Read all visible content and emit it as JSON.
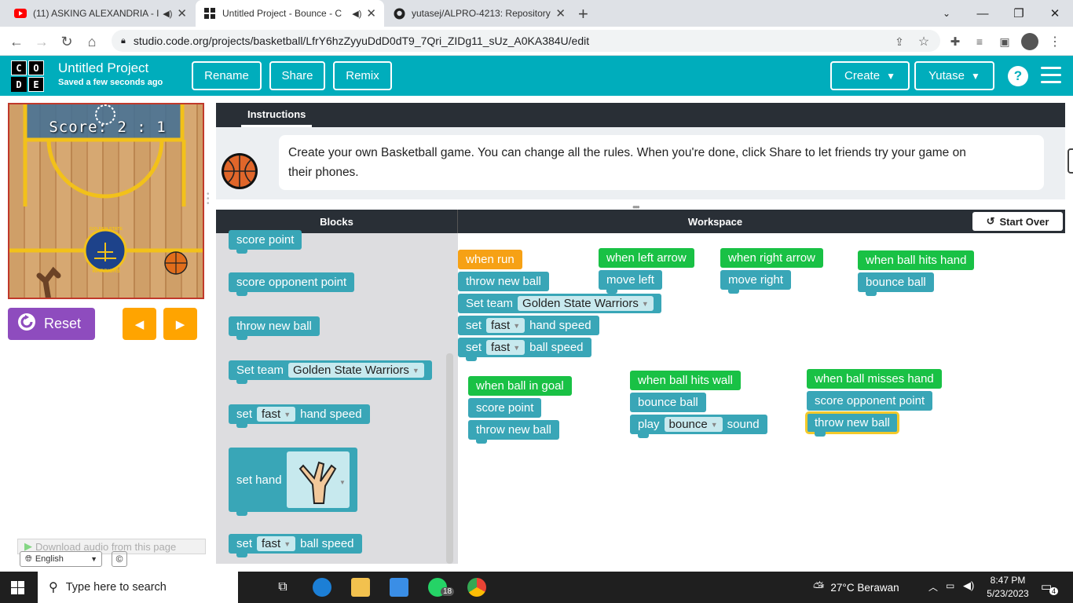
{
  "browser": {
    "tabs": [
      {
        "title": "(11) ASKING ALEXANDRIA - I",
        "icon": "youtube-icon"
      },
      {
        "title": "Untitled Project - Bounce - C",
        "icon": "codeorg-icon"
      },
      {
        "title": "yutasej/ALPRO-4213: Repository",
        "icon": "github-icon"
      }
    ],
    "url": "studio.code.org/projects/basketball/LfrY6hzZyyuDdD0dT9_7Qri_ZIDg11_sUz_A0KA384U/edit"
  },
  "header": {
    "logo_letters": [
      "C",
      "O",
      "D",
      "E"
    ],
    "title": "Untitled Project",
    "subtitle": "Saved a few seconds ago",
    "rename": "Rename",
    "share": "Share",
    "remix": "Remix",
    "create": "Create",
    "user": "Yutase",
    "help": "?"
  },
  "game": {
    "score": "Score: 2 : 1",
    "reset": "Reset",
    "logo_top": "GOLDEN STATE",
    "logo_bottom": "WARRIORS"
  },
  "instructions": {
    "tab": "Instructions",
    "text": "Create your own Basketball game. You can change all the rules. When you're done, click Share to let friends try your game on their phones."
  },
  "panels": {
    "blocks": "Blocks",
    "workspace": "Workspace",
    "start_over": "Start Over"
  },
  "toolbox": {
    "b1": "score point",
    "b2": "score opponent point",
    "b3": "throw new ball",
    "b4": "Set team",
    "b4_dd": "Golden State Warriors",
    "b5_pre": "set",
    "b5_dd": "fast",
    "b5_post": "hand speed",
    "b6": "set hand",
    "b7_pre": "set",
    "b7_dd": "fast",
    "b7_post": "ball speed"
  },
  "workspace": {
    "run": "when run",
    "run_throw": "throw new ball",
    "run_team": "Set team",
    "run_team_dd": "Golden State Warriors",
    "run_hs_pre": "set",
    "run_hs_dd": "fast",
    "run_hs_post": "hand speed",
    "run_bs_pre": "set",
    "run_bs_dd": "fast",
    "run_bs_post": "ball speed",
    "left": "when left arrow",
    "left_do": "move left",
    "right": "when right arrow",
    "right_do": "move right",
    "hand": "when ball hits hand",
    "hand_do": "bounce ball",
    "goal": "when ball in goal",
    "goal_do1": "score point",
    "goal_do2": "throw new ball",
    "wall": "when ball hits wall",
    "wall_do1": "bounce ball",
    "wall_play": "play",
    "wall_dd": "bounce",
    "wall_sound": "sound",
    "miss": "when ball misses hand",
    "miss_do1": "score opponent point",
    "miss_do2": "throw new ball"
  },
  "misc": {
    "download": "Download audio from this page",
    "language": "English",
    "copyright": "©"
  },
  "taskbar": {
    "search": "Type here to search",
    "whatsapp_badge": "18",
    "weather": "27°C  Berawan",
    "time": "8:47 PM",
    "date": "5/23/2023",
    "notif": "4"
  },
  "colors": {
    "codeorg_teal": "#00adbc",
    "block_teal": "#39a6b7",
    "event_green": "#19c145",
    "run_orange": "#f6a115",
    "reset_purple": "#8e4cbe",
    "step_orange": "#ffa400"
  }
}
